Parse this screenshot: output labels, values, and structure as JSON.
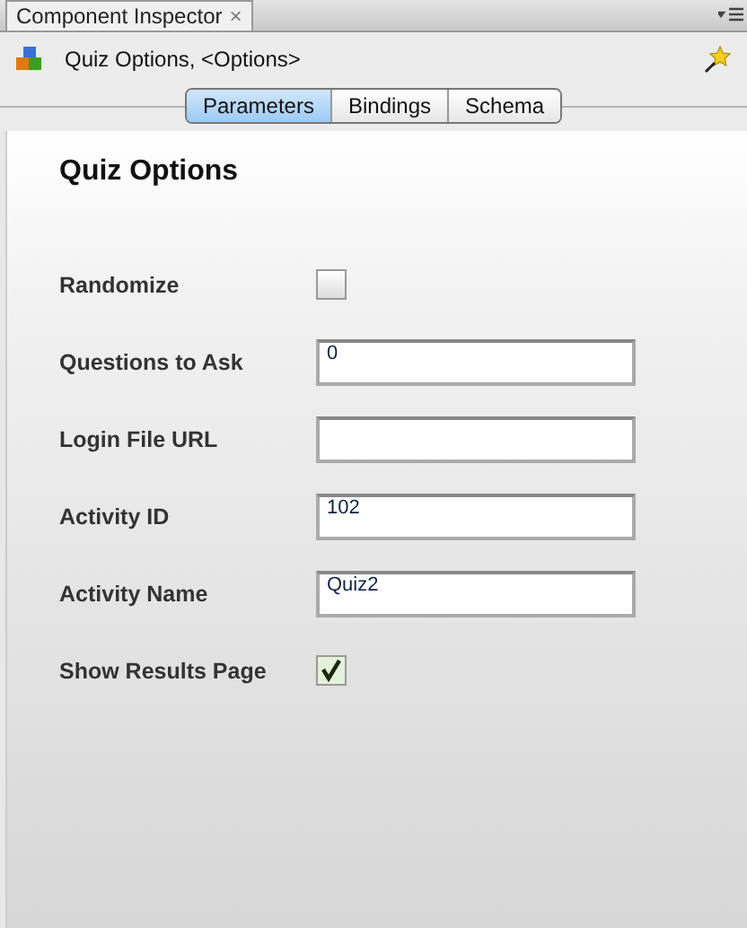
{
  "panel_tab": {
    "label": "Component Inspector",
    "close": "×"
  },
  "component": {
    "title": "Quiz Options, <Options>"
  },
  "tabs": [
    {
      "label": "Parameters",
      "selected": true
    },
    {
      "label": "Bindings",
      "selected": false
    },
    {
      "label": "Schema",
      "selected": false
    }
  ],
  "heading": "Quiz Options",
  "fields": [
    {
      "kind": "checkbox",
      "label": "Randomize",
      "checked": false
    },
    {
      "kind": "text",
      "label": "Questions to Ask",
      "value": "0"
    },
    {
      "kind": "text",
      "label": "Login File URL"
    },
    {
      "kind": "text",
      "label": "Activity ID",
      "value": "102"
    },
    {
      "kind": "text",
      "label": "Activity Name",
      "value": "Quiz2"
    },
    {
      "kind": "checkbox",
      "label": "Show Results Page",
      "checked": true
    }
  ]
}
